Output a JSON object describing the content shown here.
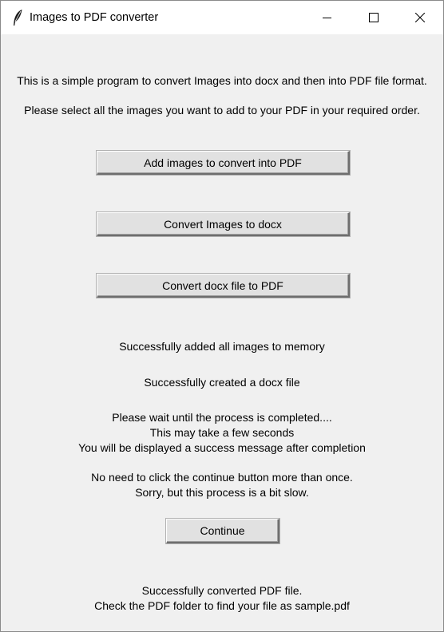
{
  "window": {
    "title": "Images to PDF converter",
    "icons": {
      "app": "feather-icon",
      "minimize": "minimize-icon",
      "maximize": "maximize-icon",
      "close": "close-icon"
    }
  },
  "intro": {
    "description": "This is a simple program to convert Images into docx and then into PDF file format.",
    "instruction": "Please select all the images you want to add to your PDF in your required order."
  },
  "buttons": {
    "add_images": "Add images to convert into PDF",
    "convert_docx": "Convert Images to docx",
    "convert_pdf": "Convert docx file to PDF",
    "continue": "Continue"
  },
  "status": {
    "images_added": "Successfully added all images to memory",
    "docx_created": "Successfully created a docx file",
    "wait_lines": [
      "Please wait until the process is completed....",
      "This may take a few seconds",
      "You will be displayed a success message after completion"
    ],
    "continue_note_lines": [
      "No need to click the continue button more than once.",
      "Sorry, but this process is a bit slow."
    ],
    "converted_lines": [
      "Successfully converted PDF file.",
      "Check the PDF folder to find your file as sample.pdf"
    ]
  }
}
